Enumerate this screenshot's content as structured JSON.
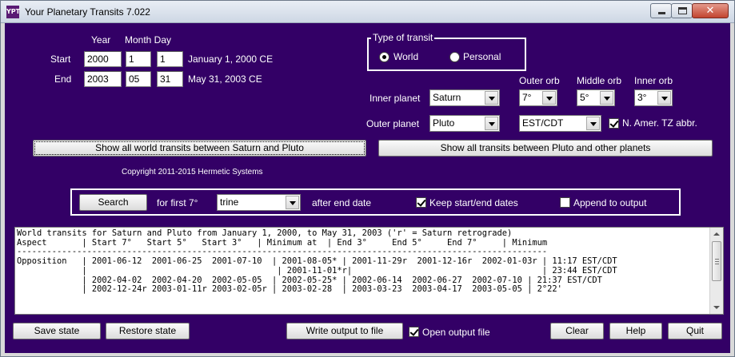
{
  "window": {
    "app_icon_text": "YPT",
    "title": "Your Planetary Transits 7.022",
    "close_glyph": "✕"
  },
  "dates": {
    "year_header": "Year",
    "month_day_header": "Month Day",
    "start_label": "Start",
    "start_year": "2000",
    "start_month": "1",
    "start_day": "1",
    "start_text": "January 1, 2000 CE",
    "end_label": "End",
    "end_year": "2003",
    "end_month": "05",
    "end_day": "31",
    "end_text": "May 31, 2003 CE"
  },
  "transit_type": {
    "title": "Type of transit",
    "world_label": "World",
    "personal_label": "Personal",
    "selected": "World"
  },
  "planets": {
    "outer_orb_label": "Outer orb",
    "middle_orb_label": "Middle orb",
    "inner_orb_label": "Inner orb",
    "inner_planet_label": "Inner planet",
    "inner_planet_value": "Saturn",
    "outer_orb_value": "7°",
    "middle_orb_value": "5°",
    "inner_orb_value": "3°",
    "outer_planet_label": "Outer planet",
    "outer_planet_value": "Pluto",
    "timezone_value": "EST/CDT",
    "tz_abbr_label": "N. Amer. TZ abbr.",
    "tz_abbr_checked": true
  },
  "actions": {
    "show_world_label": "Show all world transits between Saturn and Pluto",
    "show_all_label": "Show all transits between Pluto and other planets",
    "copyright": "Copyright 2011-2015 Hermetic Systems"
  },
  "search": {
    "button_label": "Search",
    "for_first_label": "for first 7°",
    "aspect_value": "trine",
    "after_label": "after end date",
    "keep_dates_label": "Keep start/end dates",
    "keep_dates_checked": true,
    "append_label": "Append to output",
    "append_checked": false
  },
  "output": {
    "lines": [
      "World transits for Saturn and Pluto from January 1, 2000, to May 31, 2003 ('r' = Saturn retrograde)",
      "Aspect       | Start 7°   Start 5°   Start 3°   | Minimum at  | End 3°     End 5°     End 7°     | Minimum",
      "----------------------------------------------------------------------------------------------------------",
      "Opposition   | 2001-06-12  2001-06-25  2001-07-10  | 2001-08-05* | 2001-11-29r  2001-12-16r  2002-01-03r | 11:17 EST/CDT",
      "             |                                      | 2001-11-01*r|                                      | 23:44 EST/CDT",
      "             | 2002-04-02  2002-04-20  2002-05-05  | 2002-05-25* | 2002-06-14  2002-06-27  2002-07-10 | 21:37 EST/CDT",
      "             | 2002-12-24r 2003-01-11r 2003-02-05r | 2003-02-28  | 2003-03-23  2003-04-17  2003-05-05 | 2°22'"
    ]
  },
  "bottom": {
    "save_label": "Save state",
    "restore_label": "Restore state",
    "write_label": "Write output to file",
    "open_output_label": "Open output file",
    "open_output_checked": true,
    "clear_label": "Clear",
    "help_label": "Help",
    "quit_label": "Quit"
  }
}
